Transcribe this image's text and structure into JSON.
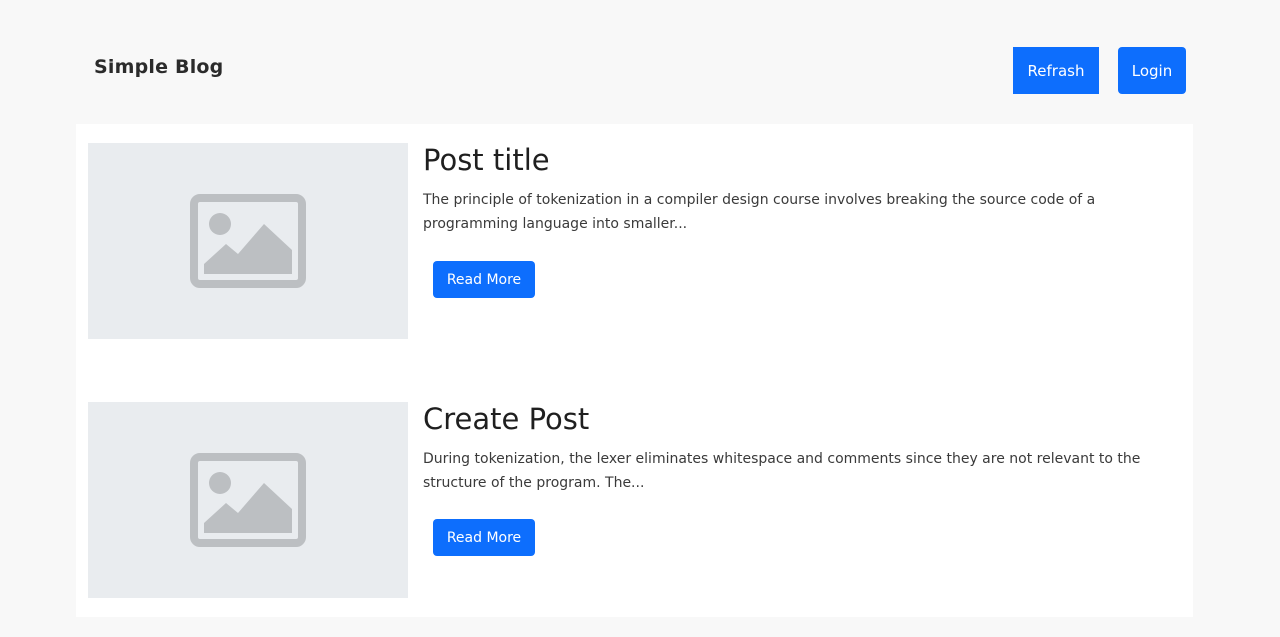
{
  "header": {
    "brand": "Simple Blog",
    "refresh_label": "Refrash",
    "login_label": "Login"
  },
  "posts": [
    {
      "title": "Post title",
      "excerpt": "The principle of tokenization in a compiler design course involves breaking the source code of a programming language into smaller...",
      "read_more_label": "Read More",
      "thumbnail_icon": "image-placeholder-icon"
    },
    {
      "title": "Create Post",
      "excerpt": "During tokenization, the lexer eliminates whitespace and comments since they are not relevant to the structure of the program. The...",
      "read_more_label": "Read More",
      "thumbnail_icon": "image-placeholder-icon"
    }
  ],
  "colors": {
    "accent": "#0d6efd",
    "page_background": "#f8f8f8",
    "thumbnail_background": "#e9ecef",
    "thumbnail_icon": "#bcbfc2"
  }
}
